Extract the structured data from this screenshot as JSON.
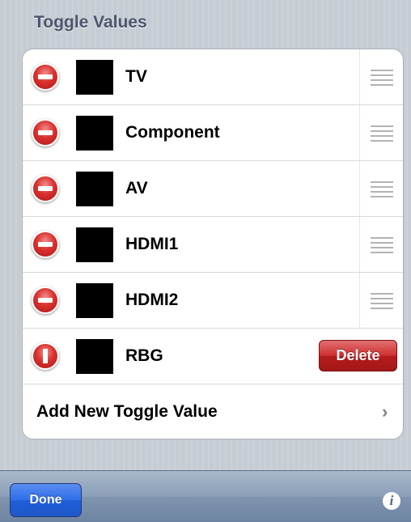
{
  "section": {
    "header": "Toggle Values"
  },
  "rows": [
    {
      "label": "TV"
    },
    {
      "label": "Component"
    },
    {
      "label": "AV"
    },
    {
      "label": "HDMI1"
    },
    {
      "label": "HDMI2"
    },
    {
      "label": "RBG",
      "delete_label": "Delete"
    }
  ],
  "add_row": {
    "label": "Add New Toggle Value",
    "chevron": "›"
  },
  "toolbar": {
    "done_label": "Done",
    "info_glyph": "i"
  },
  "icons": {
    "delete_control": "delete-circle-icon",
    "reorder": "reorder-grip-icon",
    "chevron": "chevron-right-icon",
    "info": "info-icon"
  },
  "colors": {
    "delete_red": "#d02f2f",
    "done_blue": "#2f6ee8",
    "swatch": "#000000"
  }
}
